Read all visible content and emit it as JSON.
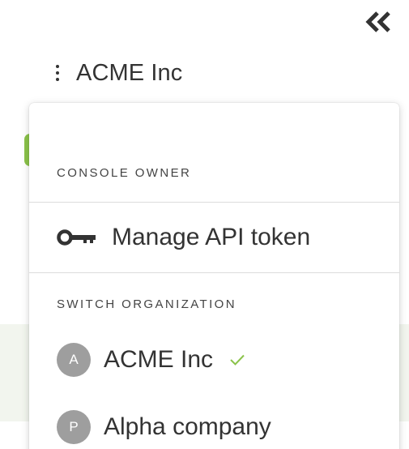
{
  "header": {
    "org_name": "ACME Inc"
  },
  "menu": {
    "console_owner_label": "CONSOLE OWNER",
    "manage_token_label": "Manage API token",
    "switch_org_label": "SWITCH ORGANIZATION",
    "organizations": [
      {
        "initial": "A",
        "name": "ACME Inc",
        "selected": true
      },
      {
        "initial": "P",
        "name": "Alpha company",
        "selected": false
      }
    ]
  },
  "icons": {
    "collapse": "double-chevron-left-icon",
    "kebab": "kebab-menu-icon",
    "key": "key-icon",
    "check": "check-icon"
  },
  "colors": {
    "text": "#333333",
    "avatar_bg": "#9e9e9e",
    "check": "#8bc34a",
    "divider": "#dcdcdc",
    "background_band": "#f2f5ee"
  }
}
